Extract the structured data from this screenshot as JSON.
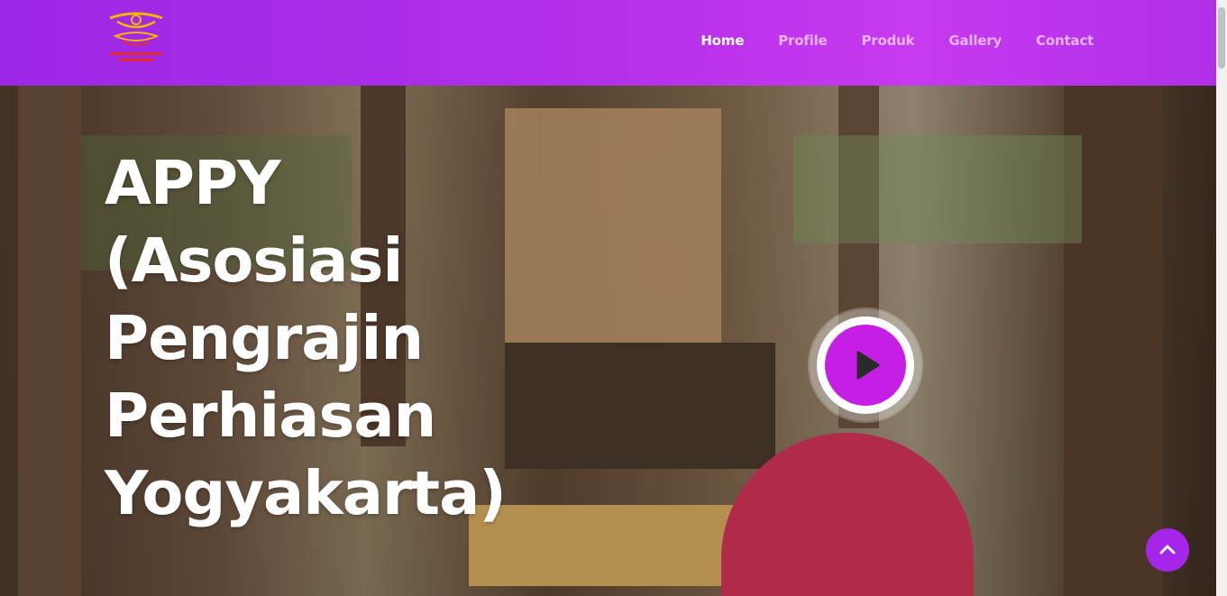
{
  "brand": {
    "logo_icon": "jewelry-ornament-logo-icon"
  },
  "nav": [
    {
      "label": "Home",
      "active": true
    },
    {
      "label": "Profile",
      "active": false
    },
    {
      "label": "Produk",
      "active": false
    },
    {
      "label": "Gallery",
      "active": false
    },
    {
      "label": "Contact",
      "active": false
    }
  ],
  "hero": {
    "title_lines": [
      "APPY",
      "(Asosiasi",
      "Pengrajin",
      "Perhiasan",
      "Yogyakarta)"
    ],
    "play_icon": "play-icon"
  },
  "scroll_top_icon": "chevron-up-icon",
  "colors": {
    "accent": "#b12ee8",
    "play": "#c51fe6",
    "scroll_top": "#a526ea"
  }
}
